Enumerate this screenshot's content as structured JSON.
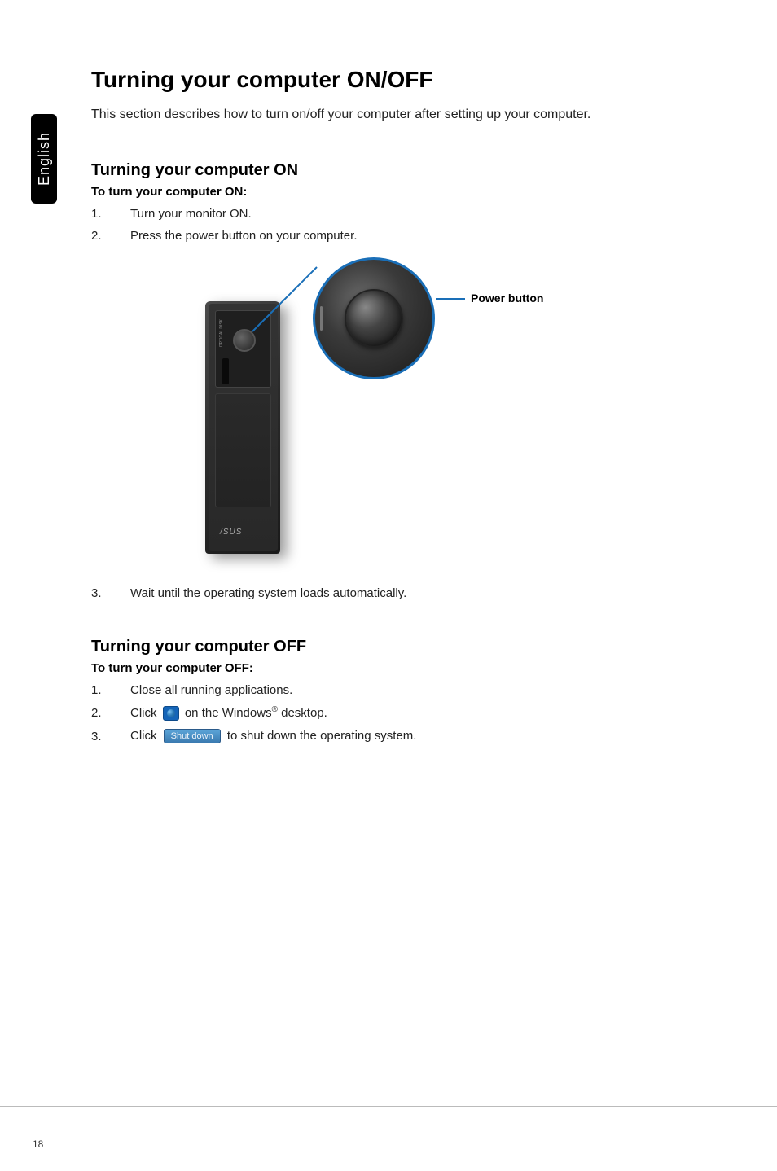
{
  "sidebar": {
    "language": "English"
  },
  "title": "Turning your computer ON/OFF",
  "intro": "This section describes how to turn on/off your computer after setting up your computer.",
  "section_on": {
    "heading": "Turning your computer ON",
    "instruction": "To turn your computer ON:",
    "steps": {
      "s1_num": "1.",
      "s1_text": "Turn your monitor ON.",
      "s2_num": "2.",
      "s2_text": "Press the power button on your computer.",
      "s3_num": "3.",
      "s3_text": "Wait until the operating system loads automatically."
    },
    "power_label": "Power button",
    "tower_logo": "/SUS",
    "optical_label": "OPTICAL DISK"
  },
  "section_off": {
    "heading": "Turning your computer OFF",
    "instruction": "To turn your computer OFF:",
    "steps": {
      "s1_num": "1.",
      "s1_text": "Close all running applications.",
      "s2_num": "2.",
      "s2_pre": "Click ",
      "s2_post": " on the Windows",
      "s2_reg": "®",
      "s2_end": " desktop.",
      "s3_num": "3.",
      "s3_pre": "Click ",
      "s3_btn": "Shut down",
      "s3_post": " to shut down the operating system."
    }
  },
  "page_number": "18"
}
